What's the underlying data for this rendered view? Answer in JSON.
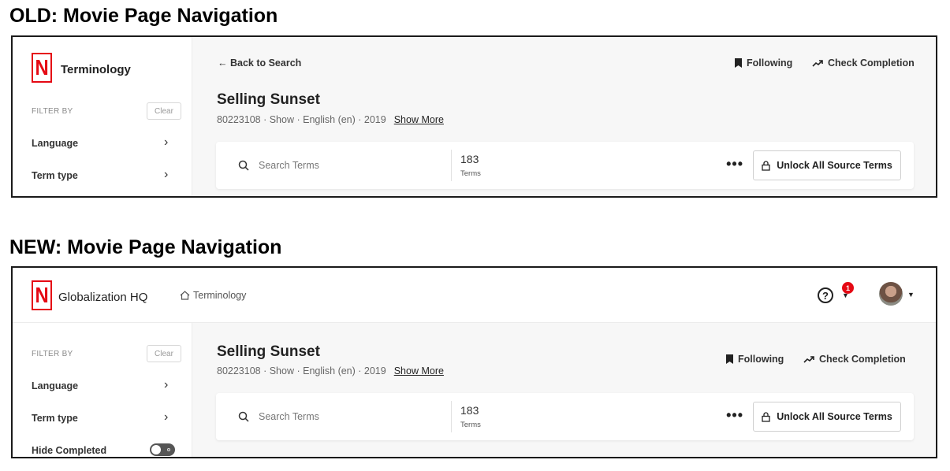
{
  "old": {
    "section_title": "OLD: Movie Page Navigation",
    "brand": {
      "logo_letter": "N",
      "name": "Terminology"
    },
    "sidebar": {
      "filter_by": "FILTER BY",
      "clear": "Clear",
      "filters": [
        {
          "label": "Language",
          "chevron": "›"
        },
        {
          "label": "Term type",
          "chevron": "›"
        }
      ]
    },
    "main": {
      "back_link": "← Back to Search",
      "following": "Following",
      "check_completion": "Check Completion",
      "title": "Selling Sunset",
      "meta": "80223108 · Show · English (en) · 2019",
      "show_more": "Show More",
      "search_placeholder": "Search Terms",
      "term_count": "183",
      "term_label": "Terms",
      "more": "•••",
      "unlock": "Unlock All Source Terms"
    }
  },
  "new": {
    "section_title": "NEW: Movie Page Navigation",
    "brand": {
      "logo_letter": "N",
      "name": "Globalization HQ"
    },
    "breadcrumb": {
      "icon": "home-icon",
      "label": "Terminology"
    },
    "header": {
      "help": "?",
      "notification_count": "1"
    },
    "sidebar": {
      "filter_by": "FILTER BY",
      "clear": "Clear",
      "filters": [
        {
          "label": "Language",
          "chevron": "›"
        },
        {
          "label": "Term type",
          "chevron": "›"
        }
      ],
      "hide_completed": "Hide Completed"
    },
    "main": {
      "following": "Following",
      "check_completion": "Check Completion",
      "title": "Selling Sunset",
      "meta": "80223108 · Show · English (en) · 2019",
      "show_more": "Show More",
      "search_placeholder": "Search Terms",
      "term_count": "183",
      "term_label": "Terms",
      "more": "•••",
      "unlock": "Unlock All Source Terms"
    }
  },
  "colors": {
    "brand_red": "#e50914",
    "frame_border": "#1a1a1a"
  }
}
